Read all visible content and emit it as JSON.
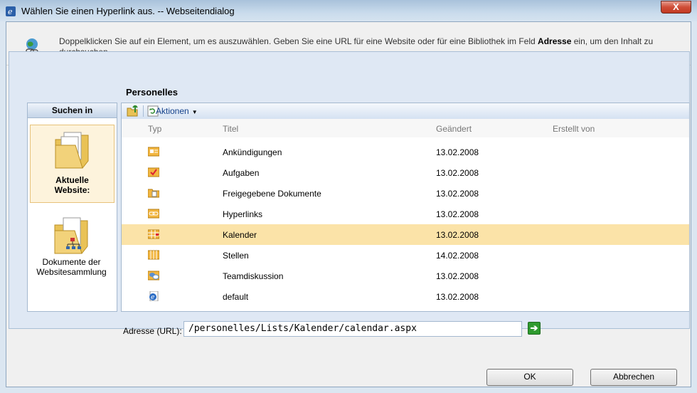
{
  "window": {
    "title": "Wählen Sie einen Hyperlink aus. -- Webseitendialog",
    "close_label": "X"
  },
  "info": {
    "text_before": "Doppelklicken Sie auf ein Element, um es auszuwählen. Geben Sie eine URL für eine Website oder für eine Bibliothek im Feld ",
    "bold_word": "Adresse",
    "text_after": " ein, um den Inhalt zu durchsuchen."
  },
  "search": {
    "header": "Suchen in",
    "items": [
      {
        "label_line1": "Aktuelle",
        "label_line2": "Website:"
      },
      {
        "label_line1": "Dokumente der",
        "label_line2": "Websitesammlung"
      }
    ]
  },
  "content": {
    "section_title": "Personelles",
    "actions_label": "Aktionen",
    "columns": {
      "type": "Typ",
      "title": "Titel",
      "changed": "Geändert",
      "created_by": "Erstellt von"
    },
    "rows": [
      {
        "icon": "announcements-icon",
        "title": "Ankündigungen",
        "changed": "13.02.2008",
        "created_by": ""
      },
      {
        "icon": "tasks-icon",
        "title": "Aufgaben",
        "changed": "13.02.2008",
        "created_by": ""
      },
      {
        "icon": "document-library-icon",
        "title": "Freigegebene Dokumente",
        "changed": "13.02.2008",
        "created_by": ""
      },
      {
        "icon": "links-icon",
        "title": "Hyperlinks",
        "changed": "13.02.2008",
        "created_by": ""
      },
      {
        "icon": "calendar-icon",
        "title": "Kalender",
        "changed": "13.02.2008",
        "created_by": "",
        "selected": true
      },
      {
        "icon": "list-icon",
        "title": "Stellen",
        "changed": "14.02.2008",
        "created_by": ""
      },
      {
        "icon": "discussion-icon",
        "title": "Teamdiskussion",
        "changed": "13.02.2008",
        "created_by": ""
      },
      {
        "icon": "web-page-icon",
        "title": "default",
        "changed": "13.02.2008",
        "created_by": ""
      }
    ]
  },
  "address": {
    "label": "Adresse (URL):",
    "value": "/personelles/Lists/Kalender/calendar.aspx"
  },
  "buttons": {
    "ok": "OK",
    "cancel": "Abbrechen"
  },
  "colors": {
    "selection": "#fbe3a8",
    "header_text": "#15428b",
    "go_green": "#2e9a2e"
  }
}
